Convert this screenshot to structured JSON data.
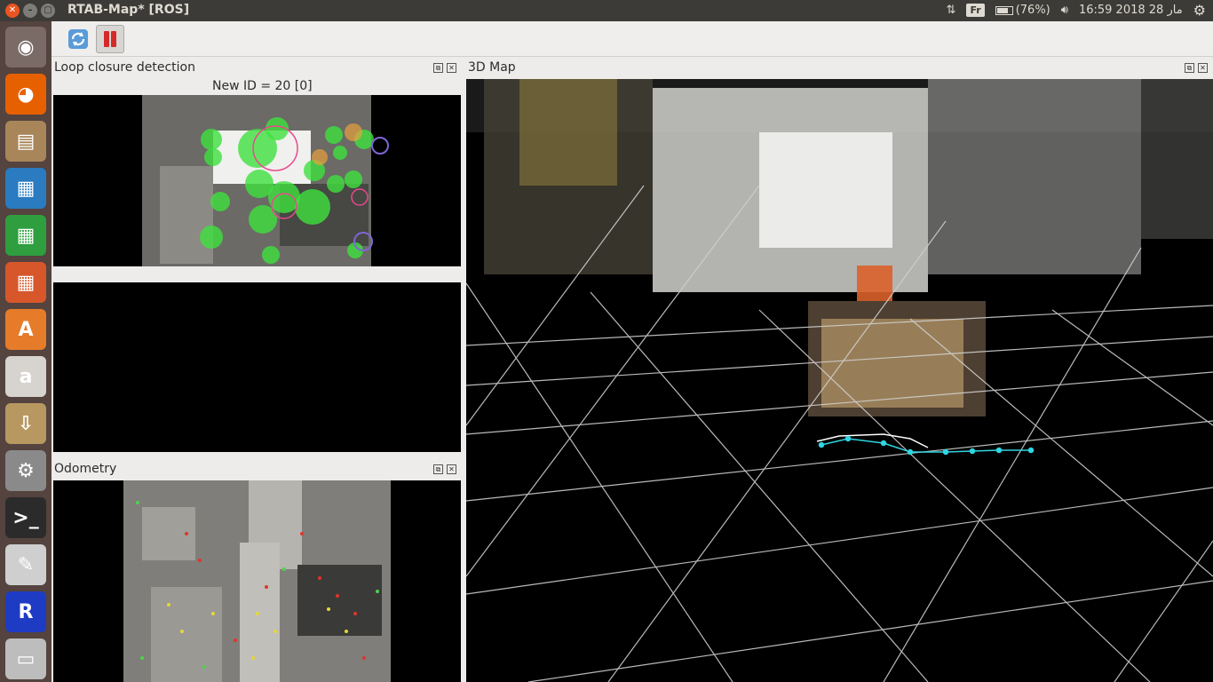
{
  "top_panel": {
    "title": "RTAB-Map* [ROS]",
    "keyboard": "Fr",
    "battery": "(76%)",
    "clock": "16:59 2018 28 مار",
    "battery_level": 0.76
  },
  "launcher": {
    "items": [
      {
        "name": "ubuntu-dash-icon",
        "glyph": "◉",
        "color": "#7a6b66"
      },
      {
        "name": "firefox-icon",
        "glyph": "◕",
        "color": "#e66000"
      },
      {
        "name": "files-icon",
        "glyph": "▤",
        "color": "#a8865a"
      },
      {
        "name": "writer-icon",
        "glyph": "▦",
        "color": "#2a7bc0"
      },
      {
        "name": "calc-icon",
        "glyph": "▦",
        "color": "#2e9e3f"
      },
      {
        "name": "impress-icon",
        "glyph": "▦",
        "color": "#d7572b"
      },
      {
        "name": "software-center-icon",
        "glyph": "A",
        "color": "#e67c2a"
      },
      {
        "name": "amazon-icon",
        "glyph": "a",
        "color": "#d7d3cf"
      },
      {
        "name": "archive-manager-icon",
        "glyph": "⇩",
        "color": "#b79860"
      },
      {
        "name": "system-settings-icon",
        "glyph": "⚙",
        "color": "#8a8a8a"
      },
      {
        "name": "terminal-icon",
        "glyph": ">_",
        "color": "#2b2b2b"
      },
      {
        "name": "text-editor-icon",
        "glyph": "✎",
        "color": "#cfcfcf"
      },
      {
        "name": "rtabmap-icon",
        "glyph": "R",
        "color": "#1e3bc4"
      },
      {
        "name": "drive-icon",
        "glyph": "▭",
        "color": "#bdbdbd"
      }
    ]
  },
  "toolbar": {
    "refresh_icon": "refresh-icon",
    "pause_icon": "pause-icon"
  },
  "loop_closure": {
    "title": "Loop closure detection",
    "new_id": "New ID = 20 [0]"
  },
  "odometry": {
    "title": "Odometry"
  },
  "map3d": {
    "title": "3D Map"
  }
}
